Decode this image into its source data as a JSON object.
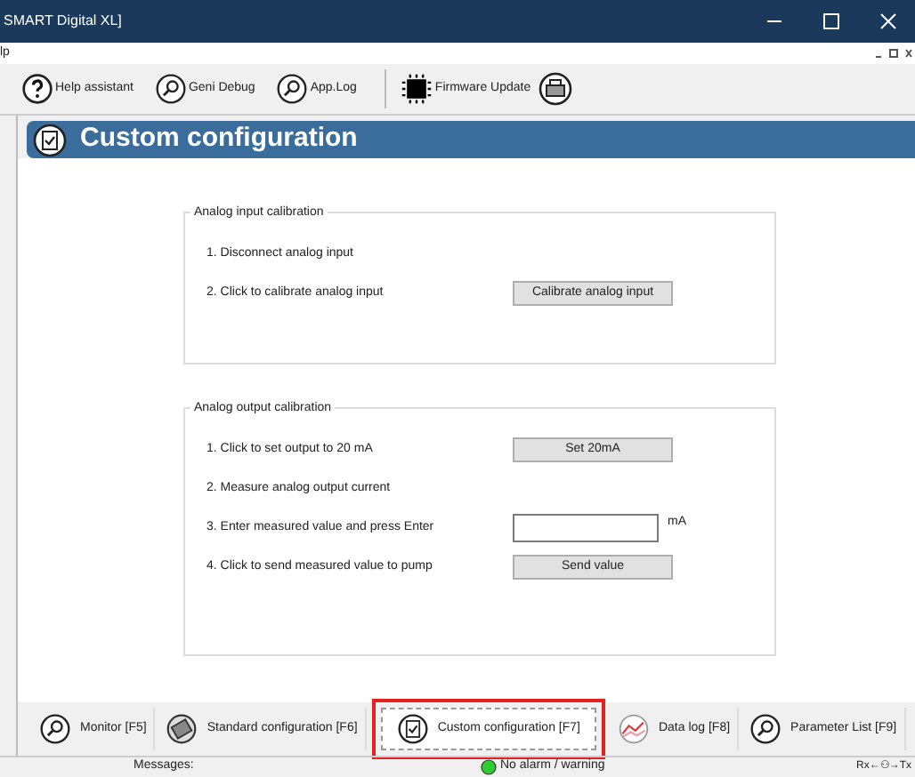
{
  "window": {
    "title": "SMART Digital XL]"
  },
  "menu": {
    "label": "lp"
  },
  "toolbar": [
    {
      "label": "Help assistant",
      "kind": "help"
    },
    {
      "label": "Geni Debug",
      "kind": "search"
    },
    {
      "label": "App.Log",
      "kind": "search"
    },
    {
      "label": "Firmware Update",
      "kind": "chip"
    }
  ],
  "header": {
    "title": "Custom configuration"
  },
  "input_group": {
    "title": "Analog input calibration",
    "steps": [
      {
        "text": "1. Disconnect analog input",
        "kind": "text"
      },
      {
        "text": "2. Click to calibrate analog input",
        "kind": "button",
        "button": "Calibrate analog input"
      }
    ]
  },
  "output_group": {
    "title": "Analog output calibration",
    "steps": [
      {
        "text": "1. Click to set output to 20 mA",
        "kind": "button",
        "button": "Set 20mA"
      },
      {
        "text": "2. Measure analog output current",
        "kind": "text"
      },
      {
        "text": "3. Enter measured value and press Enter",
        "kind": "field",
        "unit": "mA"
      },
      {
        "text": "4. Click to send measured value to pump",
        "kind": "button",
        "button": "Send value"
      }
    ]
  },
  "nav_tabs": [
    {
      "label": "Monitor [F5]",
      "kind": "search",
      "selected": false
    },
    {
      "label": "Standard configuration [F6]",
      "kind": "gear",
      "selected": false
    },
    {
      "label": "Custom configuration [F7]",
      "kind": "check",
      "selected": true
    },
    {
      "label": "Data log [F8]",
      "kind": "chart",
      "selected": false
    },
    {
      "label": "Parameter List [F9]",
      "kind": "search",
      "selected": false
    }
  ],
  "status_bar": {
    "messages_label": "Messages:",
    "alarm": "No alarm / warning",
    "io": "Rx←⚇→Tx"
  }
}
